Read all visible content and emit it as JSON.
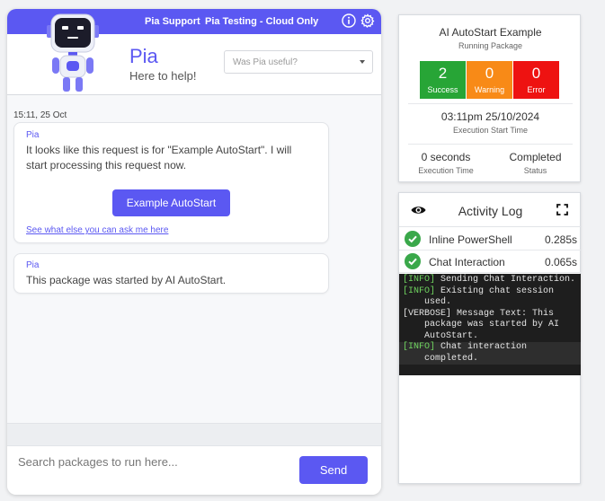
{
  "topbar": {
    "support_label": "Pia Support",
    "env_label": "Pia Testing - Cloud Only",
    "info_icon": "info-icon",
    "settings_icon": "gear-icon",
    "background": "#5b58f2"
  },
  "header": {
    "bot_name": "Pia",
    "bot_tagline": "Here to help!",
    "feedback_placeholder": "Was Pia useful?"
  },
  "chat": {
    "timestamp": "15:11, 25 Oct",
    "messages": [
      {
        "sender": "Pia",
        "text": "It looks like this request is for \"Example AutoStart\". I will start processing this request now.",
        "action_button": "Example AutoStart",
        "link": "See what else you can ask me here"
      },
      {
        "sender": "Pia",
        "text": "This package was started by AI AutoStart."
      }
    ]
  },
  "composer": {
    "placeholder": "Search packages to run here...",
    "send_label": "Send"
  },
  "status": {
    "title": "AI AutoStart Example",
    "subtitle": "Running Package",
    "counters": [
      {
        "value": "2",
        "label": "Success",
        "color": "#27a536"
      },
      {
        "value": "0",
        "label": "Warning",
        "color": "#f88a17"
      },
      {
        "value": "0",
        "label": "Error",
        "color": "#ee1211"
      }
    ],
    "start_time": "03:11pm 25/10/2024",
    "start_time_label": "Execution Start Time",
    "duration": "0 seconds",
    "duration_label": "Execution Time",
    "state": "Completed",
    "state_label": "Status"
  },
  "activity_log": {
    "title": "Activity Log",
    "steps": [
      {
        "name": "Inline PowerShell",
        "duration": "0.285s",
        "status": "success"
      },
      {
        "name": "Chat Interaction",
        "duration": "0.065s",
        "status": "success"
      }
    ],
    "console": [
      {
        "tag": "[INFO]",
        "text": "Sending Chat Interaction."
      },
      {
        "tag": "[INFO]",
        "text": "Existing chat session used."
      },
      {
        "tag": "[VERBOSE]",
        "text": "Message Text: This package was started by AI AutoStart."
      },
      {
        "tag": "[INFO]",
        "text": "Chat interaction completed."
      }
    ]
  }
}
